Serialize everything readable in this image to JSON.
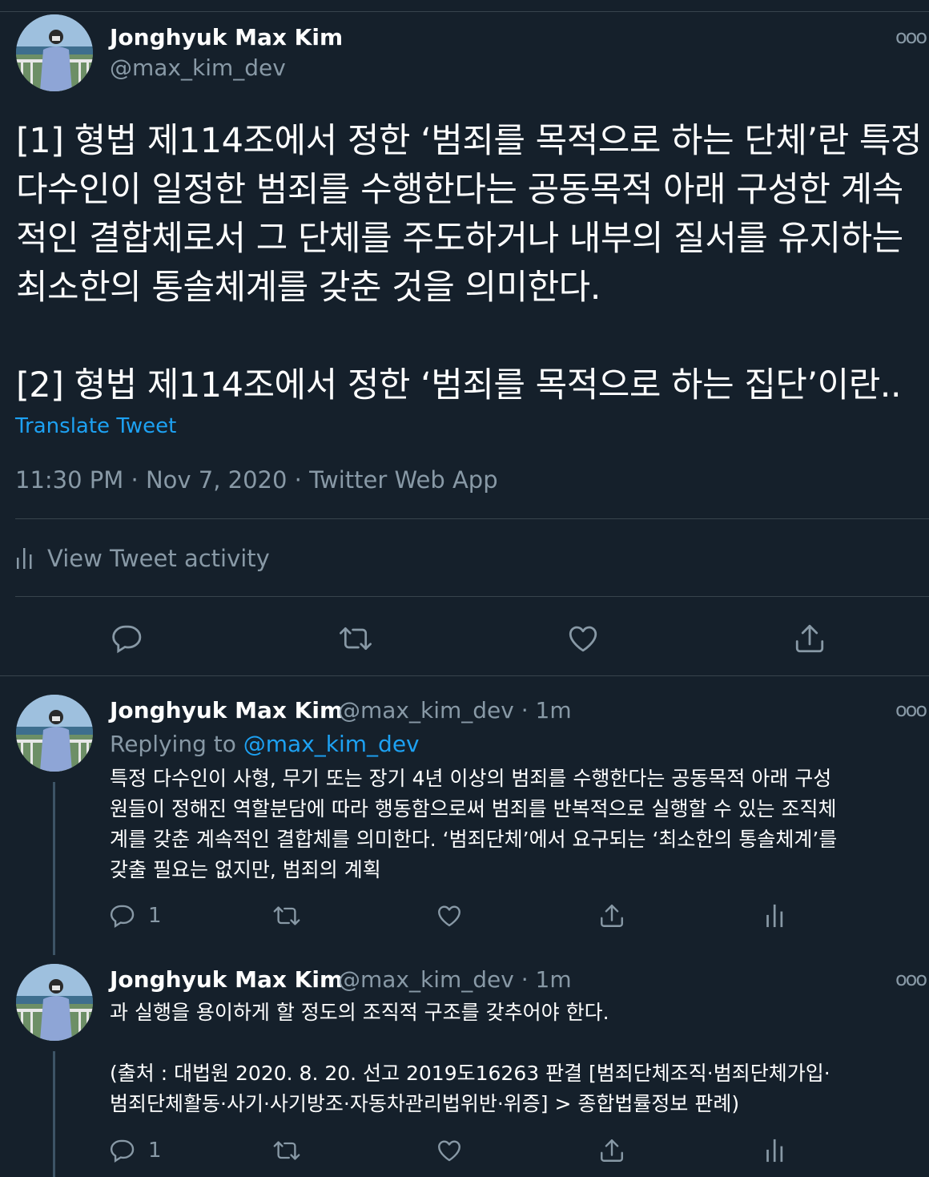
{
  "tweet": {
    "author_name": "Jonghyuk Max Kim",
    "author_handle": "@max_kim_dev",
    "text_lines": [
      "[1] 형법 제114조에서 정한 ‘범죄를 목적으로 하는 단체’란 특정",
      "다수인이 일정한 범죄를 수행한다는 공동목적 아래 구성한 계속",
      "적인 결합체로서 그 단체를 주도하거나 내부의 질서를 유지하는",
      "최소한의 통솔체계를 갖춘 것을 의미한다.",
      "",
      "[2] 형법 제114조에서 정한 ‘범죄를 목적으로 하는 집단’이란.."
    ],
    "translate_label": "Translate Tweet",
    "meta": "11:30 PM · Nov 7, 2020 · Twitter Web App",
    "activity_label": "View Tweet activity",
    "more_icon": "ooo"
  },
  "replies": [
    {
      "author_name": "Jonghyuk Max Kim",
      "author_handle": "@max_kim_dev · 1m",
      "replying_prefix": "Replying to ",
      "replying_handle": "@max_kim_dev",
      "text_lines": [
        "특정 다수인이 사형, 무기 또는 장기 4년 이상의 범죄를 수행한다는 공동목적 아래 구성",
        "원들이 정해진 역할분담에 따라 행동함으로써 범죄를 반복적으로 실행할 수 있는 조직체",
        "계를 갖춘 계속적인 결합체를 의미한다. ‘범죄단체’에서 요구되는 ‘최소한의 통솔체계’를",
        "갖출 필요는 없지만, 범죄의 계획"
      ],
      "reply_count": "1",
      "more_icon": "ooo"
    },
    {
      "author_name": "Jonghyuk Max Kim",
      "author_handle": "@max_kim_dev · 1m",
      "text_lines": [
        "과 실행을 용이하게 할 정도의 조직적 구조를 갖추어야 한다.",
        "",
        "(출처 : 대법원 2020. 8. 20. 선고 2019도16263 판결 [범죄단체조직·범죄단체가입·",
        "범죄단체활동·사기·사기방조·자동차관리법위반·위증] > 종합법률정보 판례)"
      ],
      "reply_count": "1",
      "more_icon": "ooo"
    }
  ],
  "colors": {
    "background": "#15202b",
    "text_primary": "#ffffff",
    "text_secondary": "#8899a6",
    "accent": "#1da1f2",
    "divider": "#38444d"
  },
  "icons": [
    "reply-icon",
    "retweet-icon",
    "like-icon",
    "share-icon",
    "analytics-icon",
    "more-icon"
  ]
}
